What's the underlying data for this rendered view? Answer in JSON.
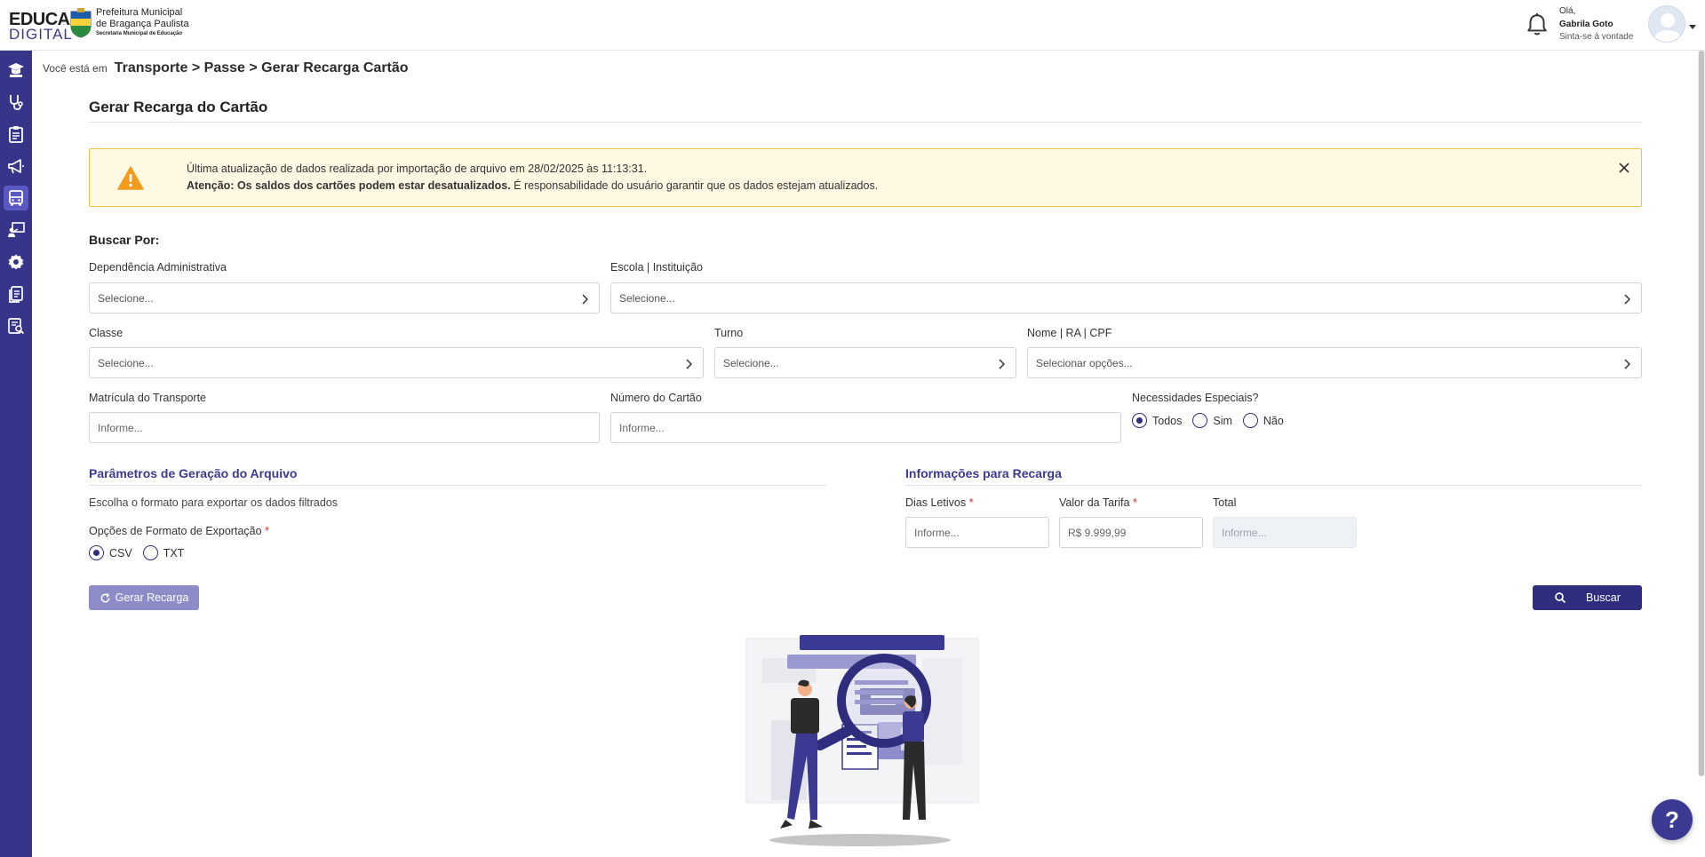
{
  "header": {
    "logo_line1": "EDUCA",
    "logo_line2": "DIGITAL",
    "org_line1": "Prefeitura Municipal",
    "org_line2": "de Bragança Paulista",
    "org_line3": "Secretaria Municipal de Educação",
    "greeting": "Olá,",
    "user_name": "Gabrila Goto",
    "user_sub": "Sinta-se à vontade",
    "icons": [
      "bell-icon",
      "avatar-icon",
      "caret-down-icon"
    ]
  },
  "sidebar": {
    "items": [
      {
        "name": "student-icon"
      },
      {
        "name": "stethoscope-icon"
      },
      {
        "name": "clipboard-icon"
      },
      {
        "name": "megaphone-icon"
      },
      {
        "name": "bus-icon",
        "active": true
      },
      {
        "name": "teacher-board-icon"
      },
      {
        "name": "settings-icon"
      },
      {
        "name": "documents-icon"
      },
      {
        "name": "report-search-icon"
      }
    ]
  },
  "breadcrumb": {
    "prefix": "Você está em",
    "path": "Transporte > Passe > Gerar Recarga Cartão"
  },
  "page": {
    "title": "Gerar Recarga do Cartão"
  },
  "alert": {
    "line1": "Última atualização de dados realizada por importação de arquivo em 28/02/2025 às 11:13:31.",
    "line2_bold": "Atenção: Os saldos dos cartões podem estar desatualizados.",
    "line2_rest": " É responsabilidade do usuário garantir que os dados estejam atualizados."
  },
  "search": {
    "heading": "Buscar Por:",
    "dependencia_label": "Dependência Administrativa",
    "dependencia_placeholder": "Selecione...",
    "escola_label": "Escola | Instituição",
    "escola_placeholder": "Selecione...",
    "classe_label": "Classe",
    "classe_placeholder": "Selecione...",
    "turno_label": "Turno",
    "turno_placeholder": "Selecione...",
    "nome_label": "Nome | RA | CPF",
    "nome_placeholder": "Selecionar opções...",
    "matricula_label": "Matrícula do Transporte",
    "matricula_placeholder": "Informe...",
    "numero_label": "Número do Cartão",
    "numero_placeholder": "Informe...",
    "necessidades_label": "Necessidades Especiais?",
    "necessidades_options": [
      "Todos",
      "Sim",
      "Não"
    ],
    "necessidades_selected": "Todos"
  },
  "params": {
    "title": "Parâmetros de Geração do Arquivo",
    "helper": "Escolha o formato para exportar os dados filtrados",
    "format_label": "Opções de Formato de Exportação",
    "format_options": [
      "CSV",
      "TXT"
    ],
    "format_selected": "CSV",
    "required_mark": "*"
  },
  "recarga": {
    "title": "Informações para Recarga",
    "dias_label": "Dias Letivos",
    "dias_placeholder": "Informe...",
    "tarifa_label": "Valor da Tarifa",
    "tarifa_placeholder": "R$ 9.999,99",
    "total_label": "Total",
    "total_placeholder": "Informe...",
    "required_mark": "*"
  },
  "actions": {
    "gerar_label": "Gerar Recarga",
    "buscar_label": "Buscar"
  },
  "help": {
    "label": "?"
  },
  "colors": {
    "primary": "#2e2d7e",
    "sidebar": "#36358a",
    "alert_bg": "#fff8e3",
    "alert_border": "#f0c04b",
    "warning": "#f29b1d",
    "required": "#d62b2b"
  }
}
